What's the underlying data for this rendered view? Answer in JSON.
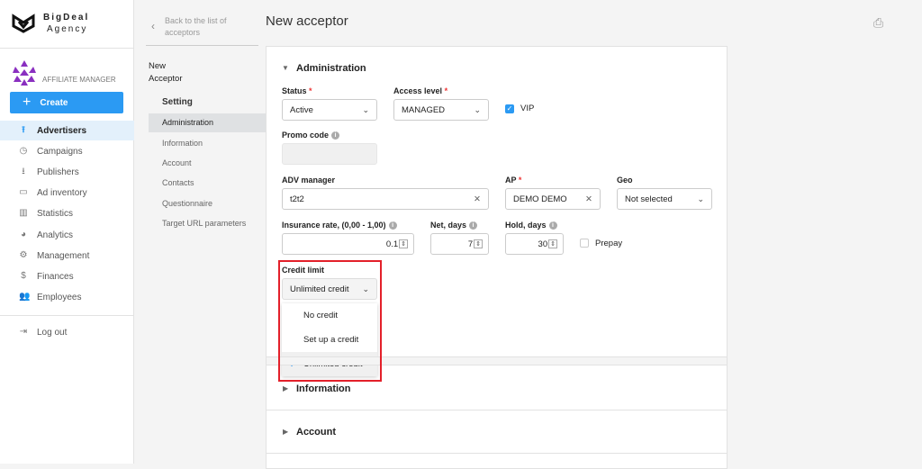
{
  "brand": {
    "line1": "BigDeal",
    "line2": "Agency",
    "role": "AFFILIATE MANAGER"
  },
  "sidebar": {
    "create": "Create",
    "items": [
      {
        "label": "Advertisers",
        "icon": "upload-icon"
      },
      {
        "label": "Campaigns",
        "icon": "play-circle-icon"
      },
      {
        "label": "Publishers",
        "icon": "download-icon"
      },
      {
        "label": "Ad inventory",
        "icon": "window-icon"
      },
      {
        "label": "Statistics",
        "icon": "bar-chart-icon"
      },
      {
        "label": "Analytics",
        "icon": "pie-icon"
      },
      {
        "label": "Management",
        "icon": "gear-box-icon"
      },
      {
        "label": "Finances",
        "icon": "dollar-icon"
      },
      {
        "label": "Employees",
        "icon": "people-icon"
      }
    ],
    "logout": "Log out"
  },
  "subnav": {
    "back": "Back to the list of acceptors",
    "title": "New Acceptor",
    "setting": "Setting",
    "items": [
      "Administration",
      "Information",
      "Account",
      "Contacts",
      "Questionnaire",
      "Target URL parameters"
    ]
  },
  "page": {
    "title": "New acceptor"
  },
  "form": {
    "section": "Administration",
    "status": {
      "label": "Status",
      "value": "Active"
    },
    "access": {
      "label": "Access level",
      "value": "MANAGED"
    },
    "vip": {
      "label": "VIP",
      "checked": true
    },
    "promo": {
      "label": "Promo code",
      "value": ""
    },
    "adv": {
      "label": "ADV manager",
      "value": "t2t2"
    },
    "ap": {
      "label": "AP",
      "value": "DEMO DEMO"
    },
    "geo": {
      "label": "Geo",
      "value": "Not selected"
    },
    "insurance": {
      "label": "Insurance rate, (0,00 - 1,00)",
      "value": "0.1"
    },
    "net": {
      "label": "Net, days",
      "value": "7"
    },
    "hold": {
      "label": "Hold, days",
      "value": "30"
    },
    "prepay": {
      "label": "Prepay",
      "checked": false
    },
    "credit": {
      "label": "Credit limit",
      "value": "Unlimited credit",
      "options": [
        "No credit",
        "Set up a credit",
        "Unlimited credit"
      ]
    }
  },
  "sections": [
    "Information",
    "Account"
  ],
  "colors": {
    "accent": "#2b9af3",
    "highlight": "#e3202a"
  }
}
